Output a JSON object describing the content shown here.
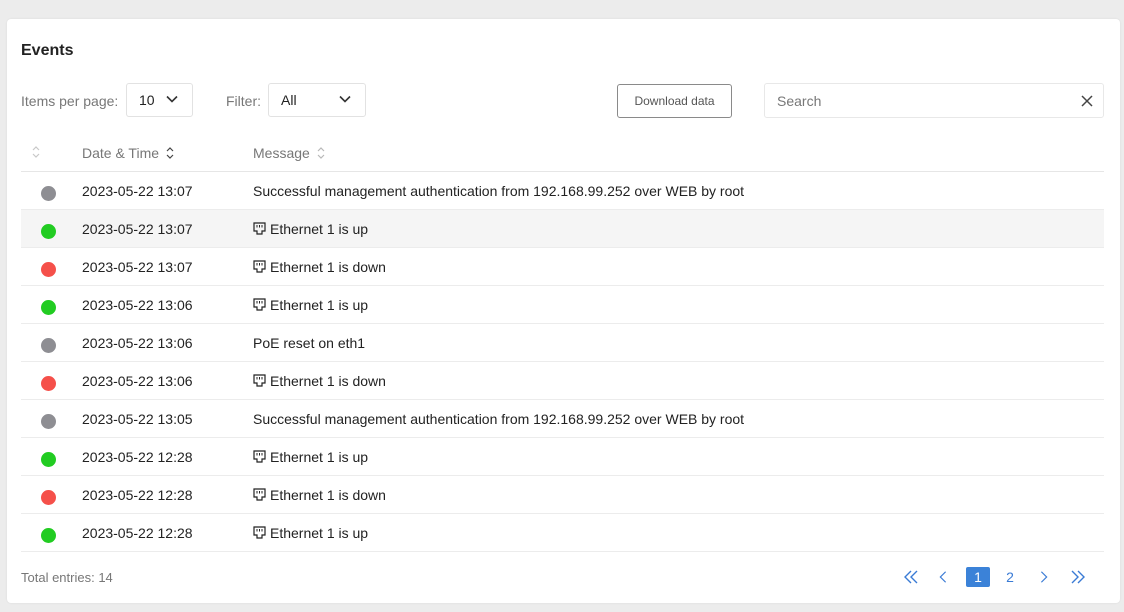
{
  "panel": {
    "title": "Events"
  },
  "controls": {
    "items_per_page_label": "Items per page:",
    "items_per_page_value": "10",
    "filter_label": "Filter:",
    "filter_value": "All",
    "download_label": "Download data",
    "search_placeholder": "Search",
    "search_value": ""
  },
  "table": {
    "columns": {
      "date": "Date & Time",
      "message": "Message"
    },
    "status_colors": {
      "info": "#8e8e93",
      "up": "#22cc22",
      "down": "#f5504a"
    },
    "rows": [
      {
        "status": "info",
        "date": "2023-05-22 13:07",
        "message": "Successful management authentication from 192.168.99.252 over WEB by root",
        "icon": ""
      },
      {
        "status": "up",
        "date": "2023-05-22 13:07",
        "message": "Ethernet 1 is up",
        "icon": "ethernet-port-icon"
      },
      {
        "status": "down",
        "date": "2023-05-22 13:07",
        "message": "Ethernet 1 is down",
        "icon": "ethernet-port-icon"
      },
      {
        "status": "up",
        "date": "2023-05-22 13:06",
        "message": "Ethernet 1 is up",
        "icon": "ethernet-port-icon"
      },
      {
        "status": "info",
        "date": "2023-05-22 13:06",
        "message": "PoE reset on eth1",
        "icon": ""
      },
      {
        "status": "down",
        "date": "2023-05-22 13:06",
        "message": "Ethernet 1 is down",
        "icon": "ethernet-port-icon"
      },
      {
        "status": "info",
        "date": "2023-05-22 13:05",
        "message": "Successful management authentication from 192.168.99.252 over WEB by root",
        "icon": ""
      },
      {
        "status": "up",
        "date": "2023-05-22 12:28",
        "message": "Ethernet 1 is up",
        "icon": "ethernet-port-icon"
      },
      {
        "status": "down",
        "date": "2023-05-22 12:28",
        "message": "Ethernet 1 is down",
        "icon": "ethernet-port-icon"
      },
      {
        "status": "up",
        "date": "2023-05-22 12:28",
        "message": "Ethernet 1 is up",
        "icon": "ethernet-port-icon"
      }
    ]
  },
  "footer": {
    "total_label": "Total entries: 14",
    "pages": [
      "1",
      "2"
    ],
    "current_page": "1",
    "accent": "#3b82d8"
  }
}
